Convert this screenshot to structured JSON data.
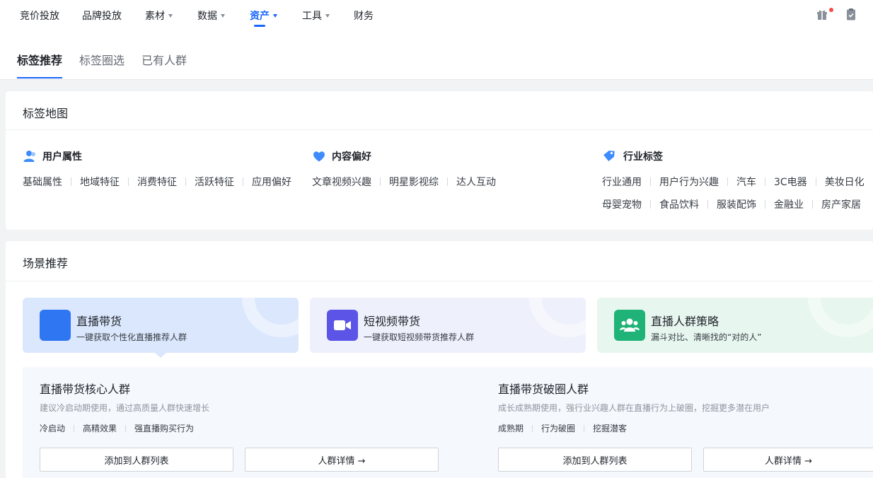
{
  "nav": {
    "items": [
      "竞价投放",
      "品牌投放",
      "素材",
      "数据",
      "资产",
      "工具",
      "财务"
    ],
    "active_index": 4,
    "accent_color": "#1966ff"
  },
  "header_icons": [
    "gift-icon",
    "clipboard-icon"
  ],
  "subtabs": {
    "items": [
      "标签推荐",
      "标签圈选",
      "已有人群"
    ],
    "active_index": 0
  },
  "tag_map": {
    "title": "标签地图",
    "categories": [
      {
        "name": "用户属性",
        "icon": "user-icon",
        "tags": [
          "基础属性",
          "地域特征",
          "消费特征",
          "活跃特征",
          "应用偏好"
        ]
      },
      {
        "name": "内容偏好",
        "icon": "heart-icon",
        "tags": [
          "文章视频兴趣",
          "明星影视综",
          "达人互动"
        ]
      },
      {
        "name": "行业标签",
        "icon": "tag-icon",
        "tags_row1": [
          "行业通用",
          "用户行为兴趣",
          "汽车",
          "3C电器",
          "美妆日化"
        ],
        "tags_row2": [
          "母婴宠物",
          "食品饮料",
          "服装配饰",
          "金融业",
          "房产家居"
        ]
      }
    ]
  },
  "scenes": {
    "title": "场景推荐",
    "items": [
      {
        "title": "直播带货",
        "subtitle": "一键获取个性化直播推荐人群",
        "icon": "live-icon",
        "bg": "#dbe7fd",
        "icon_bg": "#2f76f2"
      },
      {
        "title": "短视频带货",
        "subtitle": "一键获取短视频带货推荐人群",
        "icon": "video-camera-icon",
        "bg": "#eef0fb",
        "icon_bg": "#5c54e6"
      },
      {
        "title": "直播人群策略",
        "subtitle": "漏斗对比、清晰找的“对的人”",
        "icon": "group-users-icon",
        "bg": "#e7f6ef",
        "icon_bg": "#1fb377"
      }
    ],
    "active_index": 0
  },
  "audiences": [
    {
      "title": "直播带货核心人群",
      "desc": "建议冷启动期使用，通过高质量人群快速增长",
      "tags": [
        "冷启动",
        "高精效果",
        "强直播购买行为"
      ],
      "add_button": "添加到人群列表",
      "detail_button": "人群详情 →"
    },
    {
      "title": "直播带货破圈人群",
      "desc": "成长成熟期使用，强行业兴趣人群在直播行为上破圈，挖掘更多潜在用户",
      "tags": [
        "成熟期",
        "行为破圈",
        "挖掘潜客"
      ],
      "add_button": "添加到人群列表",
      "detail_button": "人群详情 →"
    }
  ]
}
